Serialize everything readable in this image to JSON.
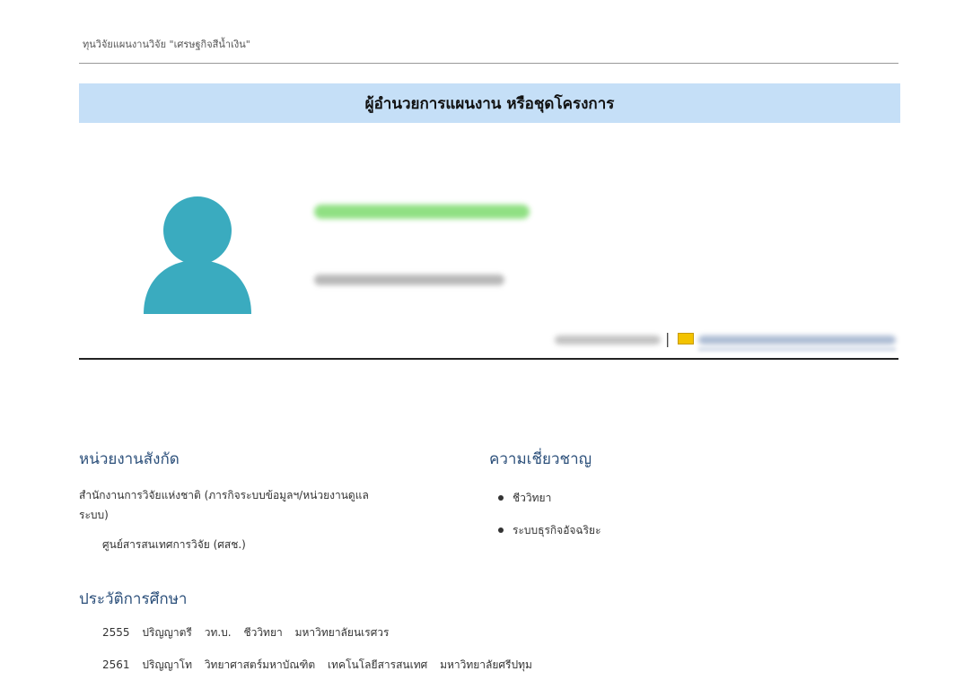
{
  "header": {
    "caption": "ทุนวิจัยแผนงานวิจัย \"เศรษฐกิจสีน้ำเงิน\"",
    "banner_title": "ผู้อำนวยการแผนงาน หรือชุดโครงการ"
  },
  "profile": {
    "avatar_icon": "user-silhouette-icon",
    "avatar_color": "#3aabbf",
    "name_color": "#7ddb6e",
    "contact_separator": "|",
    "mail_icon": "envelope-icon"
  },
  "affiliation": {
    "heading": "หน่วยงานสังกัด",
    "line1": "สำนักงานการวิจัยแห่งชาติ (ภารกิจระบบข้อมูลฯ/หน่วยงานดูแล",
    "line2": "ระบบ)",
    "sub_unit": "ศูนย์สารสนเทศการวิจัย (ศสช.)"
  },
  "expertise": {
    "heading": "ความเชี่ยวชาญ",
    "items": [
      "ชีววิทยา",
      "ระบบธุรกิจอัจฉริยะ"
    ]
  },
  "education": {
    "heading": "ประวัติการศึกษา",
    "rows": [
      {
        "year": "2555",
        "degree": "ปริญญาตรี",
        "abbr": "วท.บ.",
        "field": "ชีววิทยา",
        "institution": "มหาวิทยาลัยนเรศวร"
      },
      {
        "year": "2561",
        "degree": "ปริญญาโท",
        "abbr": "วิทยาศาสตร์มหาบัณฑิต",
        "field": "เทคโนโลยีสารสนเทศ",
        "institution": "มหาวิทยาลัยศรีปทุม"
      }
    ]
  },
  "colors": {
    "banner_bg": "#c5dff7",
    "heading_color": "#2b4f7a"
  }
}
